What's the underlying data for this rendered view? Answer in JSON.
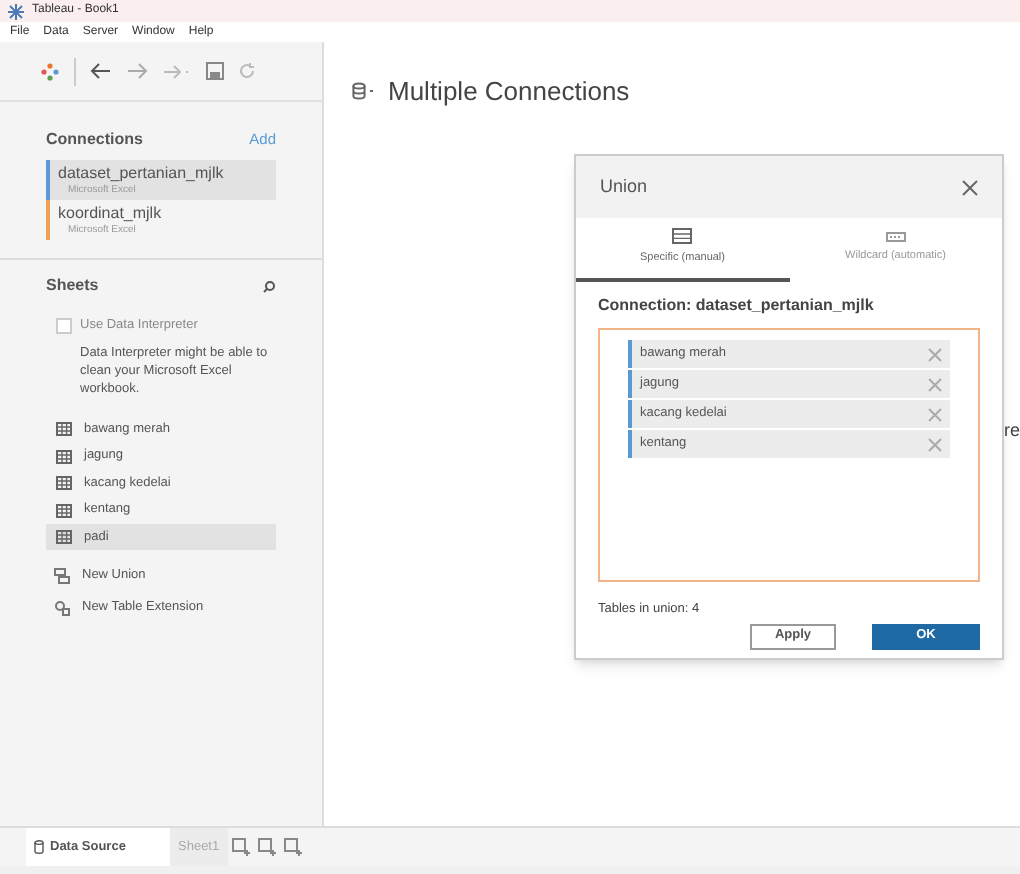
{
  "window": {
    "title": "Tableau - Book1"
  },
  "menu": [
    "File",
    "Data",
    "Server",
    "Window",
    "Help"
  ],
  "connections": {
    "title": "Connections",
    "add": "Add",
    "items": [
      {
        "name": "dataset_pertanian_mjlk",
        "type": "Microsoft Excel",
        "color": "#5b9bd5",
        "selected": true
      },
      {
        "name": "koordinat_mjlk",
        "type": "Microsoft Excel",
        "color": "#f0a050",
        "selected": false
      }
    ]
  },
  "sheets": {
    "title": "Sheets",
    "interpreter": {
      "label": "Use Data Interpreter",
      "checked": false,
      "note": "Data Interpreter might be able to clean your Microsoft Excel workbook."
    },
    "items": [
      {
        "name": "bawang merah",
        "selected": false
      },
      {
        "name": "jagung",
        "selected": false
      },
      {
        "name": "kacang kedelai",
        "selected": false
      },
      {
        "name": "kentang",
        "selected": false
      },
      {
        "name": "padi",
        "selected": true
      }
    ],
    "actions": [
      {
        "kind": "union",
        "label": "New Union"
      },
      {
        "kind": "extension",
        "label": "New Table Extension"
      }
    ]
  },
  "canvas": {
    "title": "Multiple Connections",
    "clipped_text": "re"
  },
  "dialog": {
    "title": "Union",
    "tabs": [
      {
        "kind": "specific",
        "label": "Specific (manual)",
        "selected": true
      },
      {
        "kind": "wildcard",
        "label": "Wildcard (automatic)",
        "selected": false
      }
    ],
    "connection": "Connection: dataset_pertanian_mjlk",
    "tables": [
      "bawang merah",
      "jagung",
      "kacang kedelai",
      "kentang"
    ],
    "count": "Tables in union: 4",
    "buttons": [
      {
        "kind": "secondary",
        "label": "Apply"
      },
      {
        "kind": "primary",
        "label": "OK"
      }
    ]
  },
  "bottom_tabs": [
    {
      "kind": "source",
      "label": "Data Source",
      "selected": true
    },
    {
      "kind": "sheet",
      "label": "Sheet1",
      "selected": false
    }
  ]
}
